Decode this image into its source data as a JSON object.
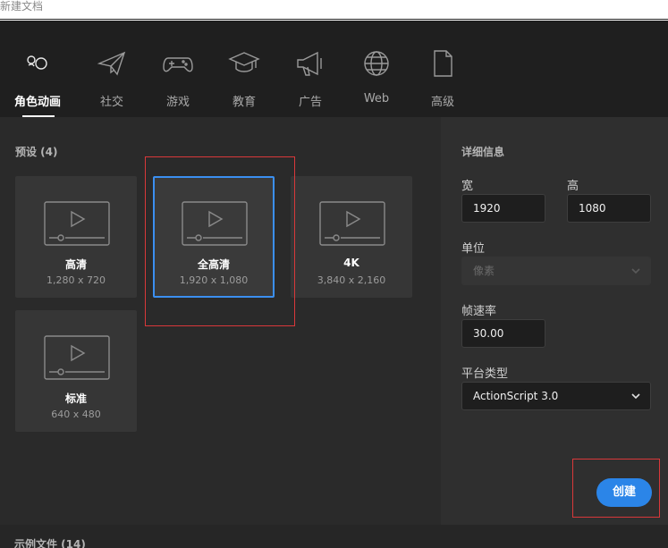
{
  "window": {
    "title": "新建文档"
  },
  "tabs": [
    {
      "label": "角色动画",
      "icon": "character-animation-icon",
      "active": true
    },
    {
      "label": "社交",
      "icon": "paper-plane-icon"
    },
    {
      "label": "游戏",
      "icon": "gamepad-icon"
    },
    {
      "label": "教育",
      "icon": "graduation-cap-icon"
    },
    {
      "label": "广告",
      "icon": "megaphone-icon"
    },
    {
      "label": "Web",
      "icon": "globe-icon"
    },
    {
      "label": "高级",
      "icon": "document-icon"
    }
  ],
  "presets": {
    "heading": "预设 (4)",
    "items": [
      {
        "name": "高清",
        "dims": "1,280 x 720"
      },
      {
        "name": "全高清",
        "dims": "1,920 x 1,080",
        "selected": true
      },
      {
        "name": "4K",
        "dims": "3,840 x 2,160"
      },
      {
        "name": "标准",
        "dims": "640 x 480"
      }
    ]
  },
  "details": {
    "heading": "详细信息",
    "width_label": "宽",
    "width_value": "1920",
    "height_label": "高",
    "height_value": "1080",
    "unit_label": "单位",
    "unit_value": "像素",
    "fps_label": "帧速率",
    "fps_value": "30.00",
    "platform_label": "平台类型",
    "platform_value": "ActionScript 3.0",
    "create_label": "创建"
  },
  "samples": {
    "heading": "示例文件 (14)"
  },
  "colors": {
    "accent": "#2b85e8",
    "highlight": "#d9383a"
  }
}
